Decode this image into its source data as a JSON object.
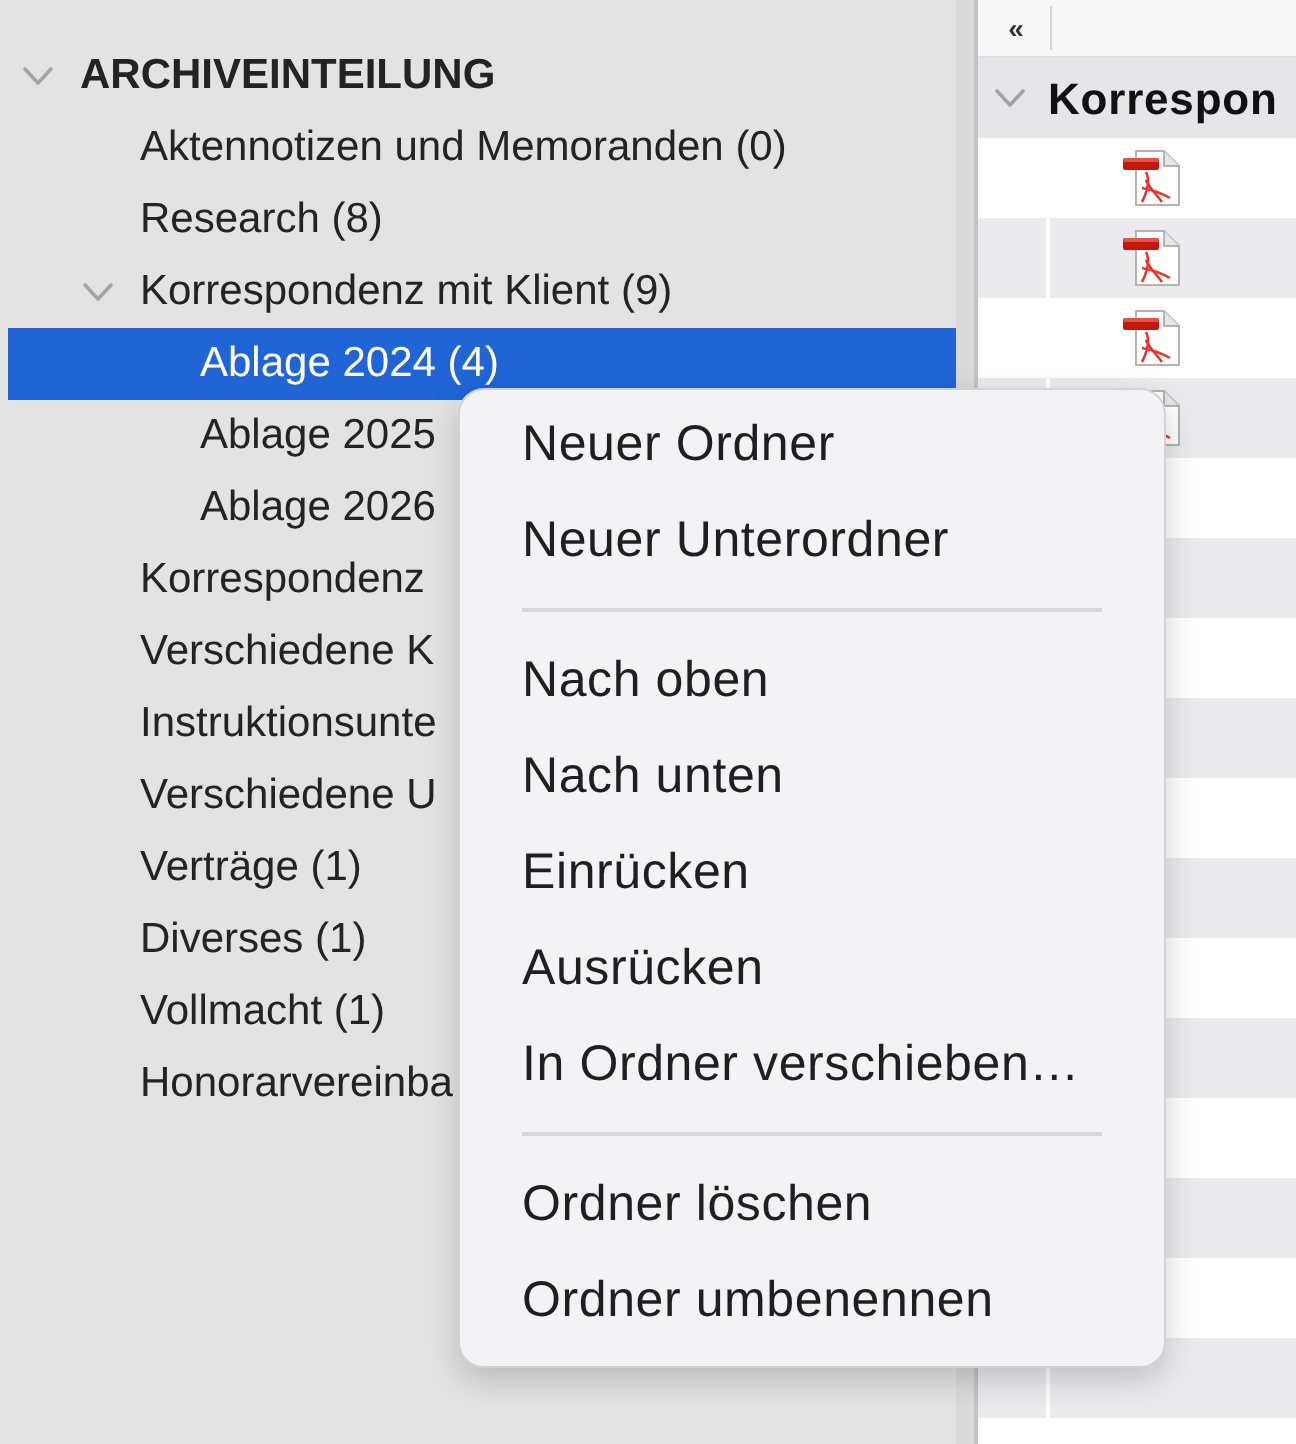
{
  "sidebar": {
    "tree": [
      {
        "label": "ARCHIVEINTEILUNG",
        "selected": false,
        "expanded": true,
        "children": [
          {
            "label": "Aktennotizen und Memoranden (0)",
            "selected": false
          },
          {
            "label": "Research (8)",
            "selected": false
          },
          {
            "label": "Korrespondenz mit Klient (9)",
            "selected": false,
            "expanded": true,
            "children": [
              {
                "label": "Ablage 2024 (4)",
                "selected": true
              },
              {
                "label": "Ablage 2025",
                "selected": false
              },
              {
                "label": "Ablage 2026",
                "selected": false
              }
            ]
          },
          {
            "label": "Korrespondenz",
            "selected": false
          },
          {
            "label": "Verschiedene K",
            "selected": false
          },
          {
            "label": "Instruktionsunte",
            "selected": false
          },
          {
            "label": "Verschiedene U",
            "selected": false
          },
          {
            "label": "Verträge (1)",
            "selected": false
          },
          {
            "label": "Diverses (1)",
            "selected": false
          },
          {
            "label": "Vollmacht (1)",
            "selected": false
          },
          {
            "label": "Honorarvereinba",
            "selected": false
          }
        ]
      }
    ]
  },
  "file_list": {
    "collapse_button": "«",
    "group": {
      "label": "Korrespon",
      "expanded": true
    },
    "files": [
      {
        "kind": "pdf"
      },
      {
        "kind": "pdf"
      },
      {
        "kind": "pdf"
      },
      {
        "kind": "pdf"
      }
    ]
  },
  "context_menu": {
    "sections": [
      [
        "Neuer Ordner",
        "Neuer Unterordner"
      ],
      [
        "Nach oben",
        "Nach unten",
        "Einrücken",
        "Ausrücken",
        "In Ordner verschieben…"
      ],
      [
        "Ordner löschen",
        "Ordner umbenennen"
      ]
    ]
  }
}
